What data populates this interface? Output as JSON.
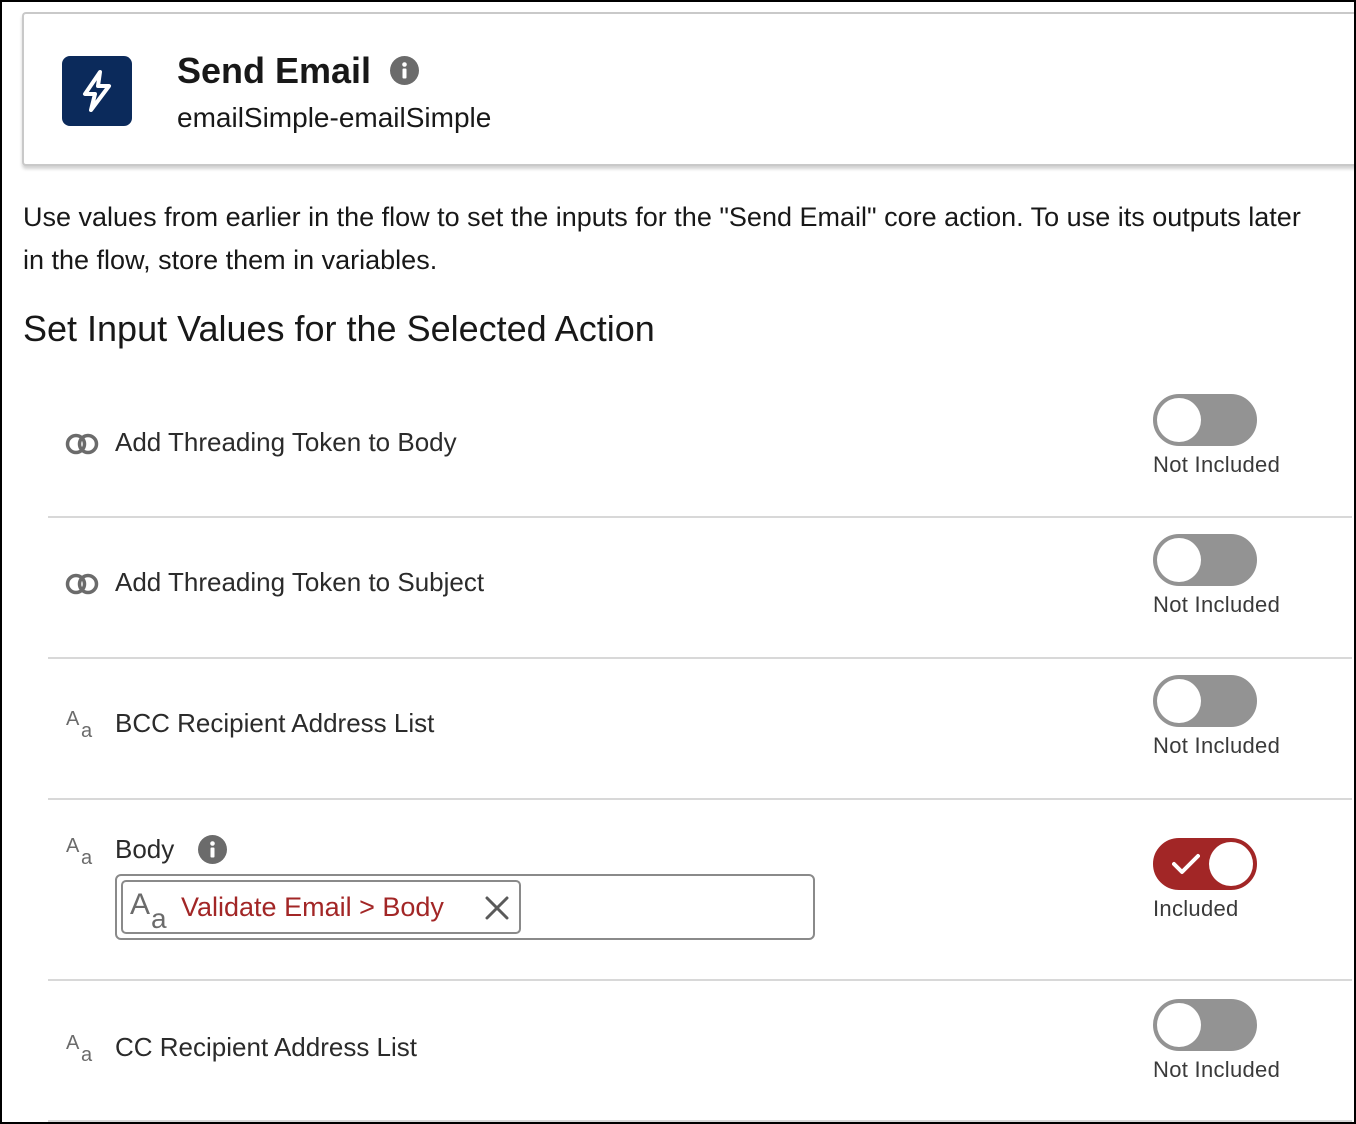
{
  "header": {
    "title": "Send Email",
    "subtitle": "emailSimple-emailSimple",
    "icon": "lightning-bolt-icon",
    "icon_bg": "#0b2a5b"
  },
  "description": "Use values from earlier in the flow to set the inputs for the \"Send Email\" core action. To use its outputs later in the flow, store them in variables.",
  "section_heading": "Set Input Values for the Selected Action",
  "rows": [
    {
      "icon": "boolean-icon",
      "label": "Add Threading Token to Body",
      "included": false,
      "status": "Not Included"
    },
    {
      "icon": "boolean-icon",
      "label": "Add Threading Token to Subject",
      "included": false,
      "status": "Not Included"
    },
    {
      "icon": "text-type-icon",
      "label": "BCC Recipient Address List",
      "included": false,
      "status": "Not Included"
    },
    {
      "icon": "text-type-icon",
      "label": "Body",
      "included": true,
      "status": "Included",
      "value": {
        "icon": "text-type-icon",
        "text": "Validate Email > Body"
      }
    },
    {
      "icon": "text-type-icon",
      "label": "CC Recipient Address List",
      "included": false,
      "status": "Not Included"
    }
  ],
  "colors": {
    "toggle_on": "#a22626",
    "toggle_off": "#939393",
    "resource_text": "#a22626"
  }
}
